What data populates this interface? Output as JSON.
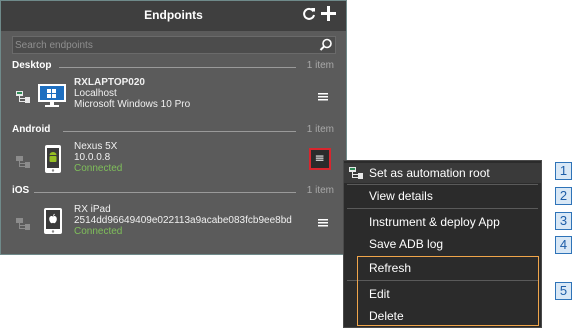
{
  "panel": {
    "title": "Endpoints",
    "refresh_icon": "refresh-icon",
    "add_icon": "plus-icon",
    "search_placeholder": "Search endpoints"
  },
  "sections": [
    {
      "name": "Desktop",
      "count": "1 item"
    },
    {
      "name": "Android",
      "count": "1 item"
    },
    {
      "name": "iOS",
      "count": "1 item"
    }
  ],
  "devices": [
    {
      "name": "RXLAPTOP020",
      "line2": "Localhost",
      "line3": "Microsoft Windows 10 Pro",
      "icon": "windows-monitor-icon"
    },
    {
      "name": "Nexus 5X",
      "line2": "10.0.0.8",
      "line3": "Connected",
      "icon": "android-phone-icon"
    },
    {
      "name": "RX iPad",
      "line2": "2514dd96649409e022113a9acabe083fcb9ee8bd",
      "line3": "Connected",
      "icon": "apple-tablet-icon"
    }
  ],
  "context_menu": {
    "items": [
      "Set as automation root",
      "View details",
      "Instrument & deploy App",
      "Save ADB log",
      "Refresh",
      "Edit",
      "Delete"
    ]
  },
  "callouts": [
    "1",
    "2",
    "3",
    "4",
    "5"
  ],
  "colors": {
    "panel_bg": "#5b5b5b",
    "header_bg": "#3f3f3f",
    "menu_bg": "#2b2b2b",
    "connected": "#7fbf5a",
    "highlight_border": "#d8262e",
    "group_border": "#f0a54a",
    "callout_border": "#2e73b8"
  }
}
